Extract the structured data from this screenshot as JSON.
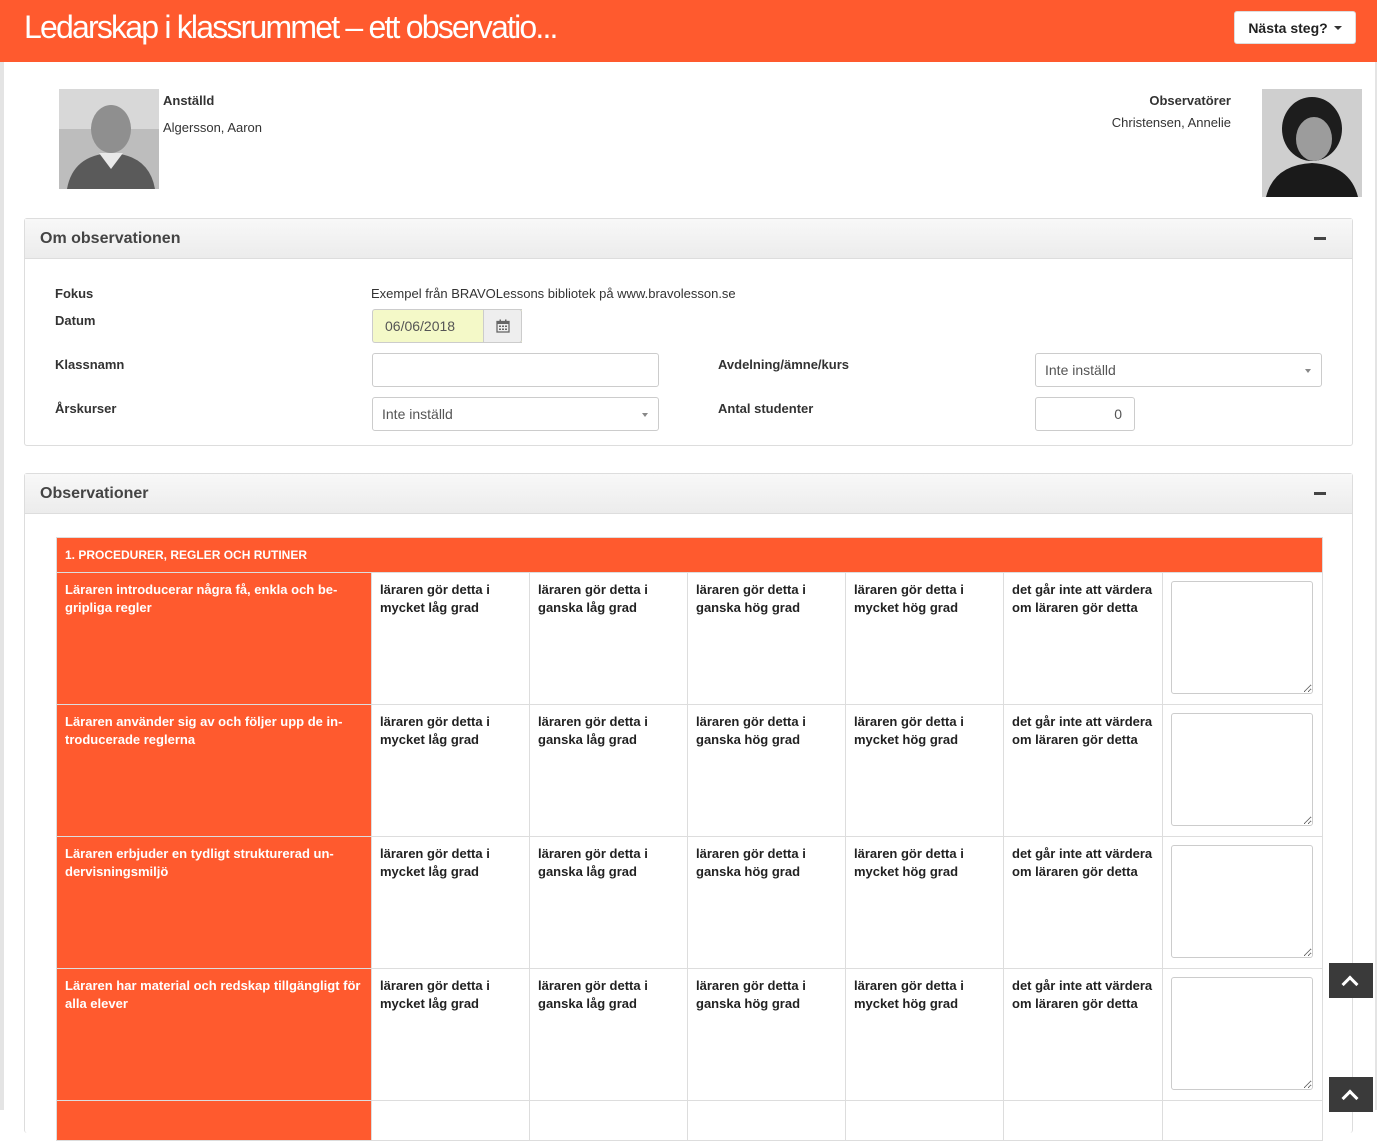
{
  "header": {
    "title": "Ledarskap i klassrummet – ett observatio...",
    "next_button": "Nästa steg?"
  },
  "employee": {
    "label": "Anställd",
    "name": "Algersson, Aaron"
  },
  "observers": {
    "label": "Observatörer",
    "name": "Christensen, Annelie"
  },
  "about": {
    "title": "Om observationen",
    "focus_label": "Fokus",
    "focus_value": "Exempel från BRAVOLessons bibliotek på www.bravolesson.se",
    "date_label": "Datum",
    "date_value": "06/06/2018",
    "class_label": "Klassnamn",
    "class_value": "",
    "dept_label": "Avdelning/ämne/kurs",
    "dept_value": "Inte inställd",
    "grade_label": "Årskurser",
    "grade_value": "Inte inställd",
    "students_label": "Antal studenter",
    "students_value": "0"
  },
  "observations": {
    "title": "Observationer",
    "section_title": "1. PROCEDURER, REGLER OCH RUTINER",
    "options": [
      "läraren gör detta i mycket låg grad",
      "läraren gör detta i ganska låg grad",
      "läraren gör detta i ganska hög grad",
      "läraren gör detta i mycket hög grad",
      "det går inte att värdera om läraren gör detta"
    ],
    "questions": [
      "Läraren introducerar några få, enkla och be-gripliga regler",
      "Läraren använder sig av och följer upp de in-troducerade reglerna",
      "Läraren erbjuder en tydligt strukturerad un-dervisningsmiljö",
      "Läraren har material och redskap tillgängligt för alla elever"
    ]
  },
  "colors": {
    "accent": "#ff5a2e",
    "date_highlight": "#f4f9c8"
  },
  "icons": [
    "calendar-icon",
    "minus-icon",
    "chevron-up-icon",
    "caret-down-icon"
  ]
}
